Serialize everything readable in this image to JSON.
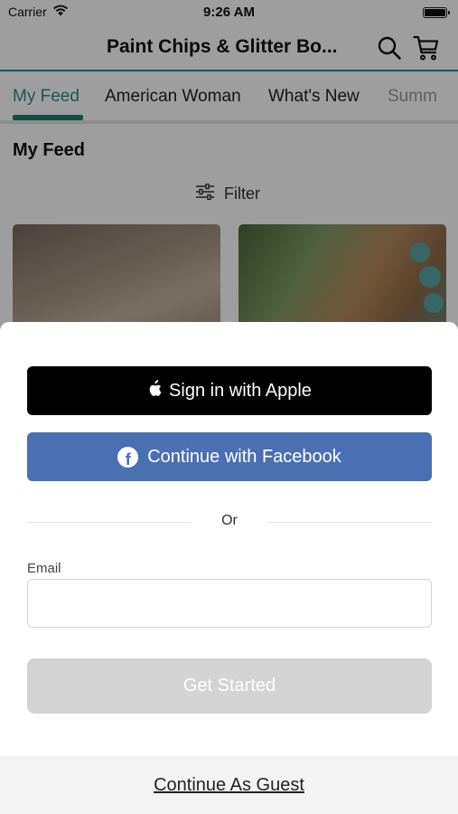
{
  "status_bar": {
    "carrier": "Carrier",
    "time": "9:26 AM"
  },
  "nav": {
    "title": "Paint Chips & Glitter Bo..."
  },
  "tabs": [
    {
      "label": "My Feed",
      "active": true
    },
    {
      "label": "American Woman",
      "active": false
    },
    {
      "label": "What's New",
      "active": false
    },
    {
      "label": "Summ",
      "active": false
    }
  ],
  "feed": {
    "heading": "My Feed",
    "filter_label": "Filter"
  },
  "sheet": {
    "apple_label": "Sign in with Apple",
    "facebook_label": "Continue with Facebook",
    "divider_text": "Or",
    "email_label": "Email",
    "email_value": "",
    "email_placeholder": "",
    "get_started_label": "Get Started",
    "guest_label": "Continue As Guest"
  },
  "colors": {
    "accent_teal": "#2e8b86",
    "facebook_blue": "#4a6fb3",
    "apple_black": "#000000",
    "disabled_gray": "#d3d3d3"
  },
  "icons": [
    "wifi-icon",
    "battery-icon",
    "search-icon",
    "cart-icon",
    "filter-icon",
    "apple-icon",
    "facebook-icon"
  ]
}
